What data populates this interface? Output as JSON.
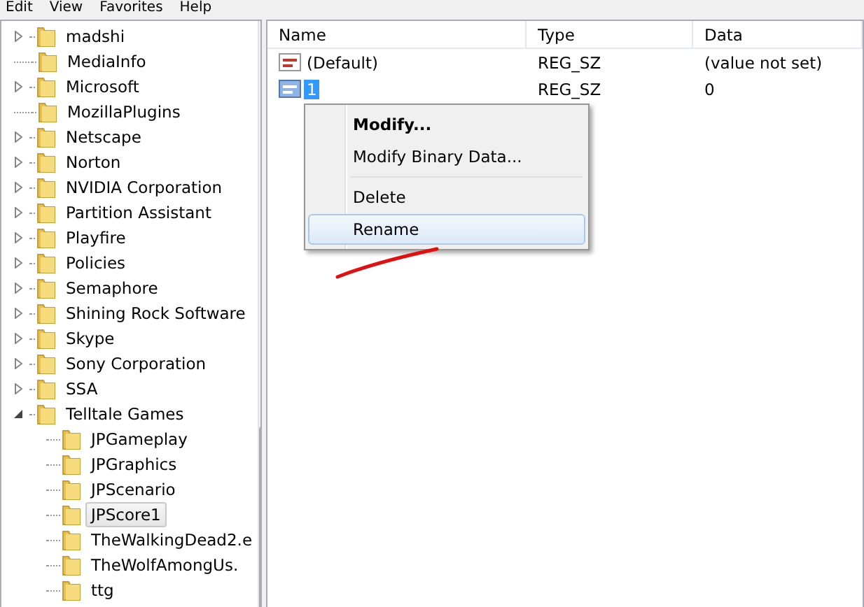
{
  "menu_bar": [
    "Edit",
    "View",
    "Favorites",
    "Help"
  ],
  "tree": [
    {
      "label": "madshi",
      "expandable": true,
      "expanded": false,
      "selected": false
    },
    {
      "label": "MediaInfo",
      "expandable": false,
      "expanded": false,
      "selected": false
    },
    {
      "label": "Microsoft",
      "expandable": true,
      "expanded": false,
      "selected": false
    },
    {
      "label": "MozillaPlugins",
      "expandable": false,
      "expanded": false,
      "selected": false
    },
    {
      "label": "Netscape",
      "expandable": true,
      "expanded": false,
      "selected": false
    },
    {
      "label": "Norton",
      "expandable": true,
      "expanded": false,
      "selected": false
    },
    {
      "label": "NVIDIA Corporation",
      "expandable": true,
      "expanded": false,
      "selected": false
    },
    {
      "label": "Partition Assistant",
      "expandable": true,
      "expanded": false,
      "selected": false
    },
    {
      "label": "Playfire",
      "expandable": true,
      "expanded": false,
      "selected": false
    },
    {
      "label": "Policies",
      "expandable": true,
      "expanded": false,
      "selected": false
    },
    {
      "label": "Semaphore",
      "expandable": true,
      "expanded": false,
      "selected": false
    },
    {
      "label": "Shining Rock Software",
      "expandable": true,
      "expanded": false,
      "selected": false
    },
    {
      "label": "Skype",
      "expandable": true,
      "expanded": false,
      "selected": false
    },
    {
      "label": "Sony Corporation",
      "expandable": true,
      "expanded": false,
      "selected": false
    },
    {
      "label": "SSA",
      "expandable": true,
      "expanded": false,
      "selected": false
    },
    {
      "label": "Telltale Games",
      "expandable": true,
      "expanded": true,
      "selected": false,
      "children": [
        {
          "label": "JPGameplay",
          "selected": false
        },
        {
          "label": "JPGraphics",
          "selected": false
        },
        {
          "label": "JPScenario",
          "selected": false
        },
        {
          "label": "JPScore1",
          "selected": true
        },
        {
          "label": "TheWalkingDead2.e",
          "selected": false
        },
        {
          "label": "TheWolfAmongUs.",
          "selected": false
        },
        {
          "label": "ttg",
          "selected": false
        }
      ]
    }
  ],
  "table": {
    "columns": [
      "Name",
      "Type",
      "Data"
    ],
    "rows": [
      {
        "name": "(Default)",
        "type": "REG_SZ",
        "data": "(value not set)",
        "editing": false
      },
      {
        "name": "1",
        "type": "REG_SZ",
        "data": "0",
        "editing": true
      }
    ]
  },
  "context_menu": [
    {
      "kind": "item",
      "label": "Modify...",
      "default": true,
      "hovered": false
    },
    {
      "kind": "item",
      "label": "Modify Binary Data...",
      "default": false,
      "hovered": false
    },
    {
      "kind": "separator"
    },
    {
      "kind": "item",
      "label": "Delete",
      "default": false,
      "hovered": false
    },
    {
      "kind": "item",
      "label": "Rename",
      "default": false,
      "hovered": true
    }
  ]
}
